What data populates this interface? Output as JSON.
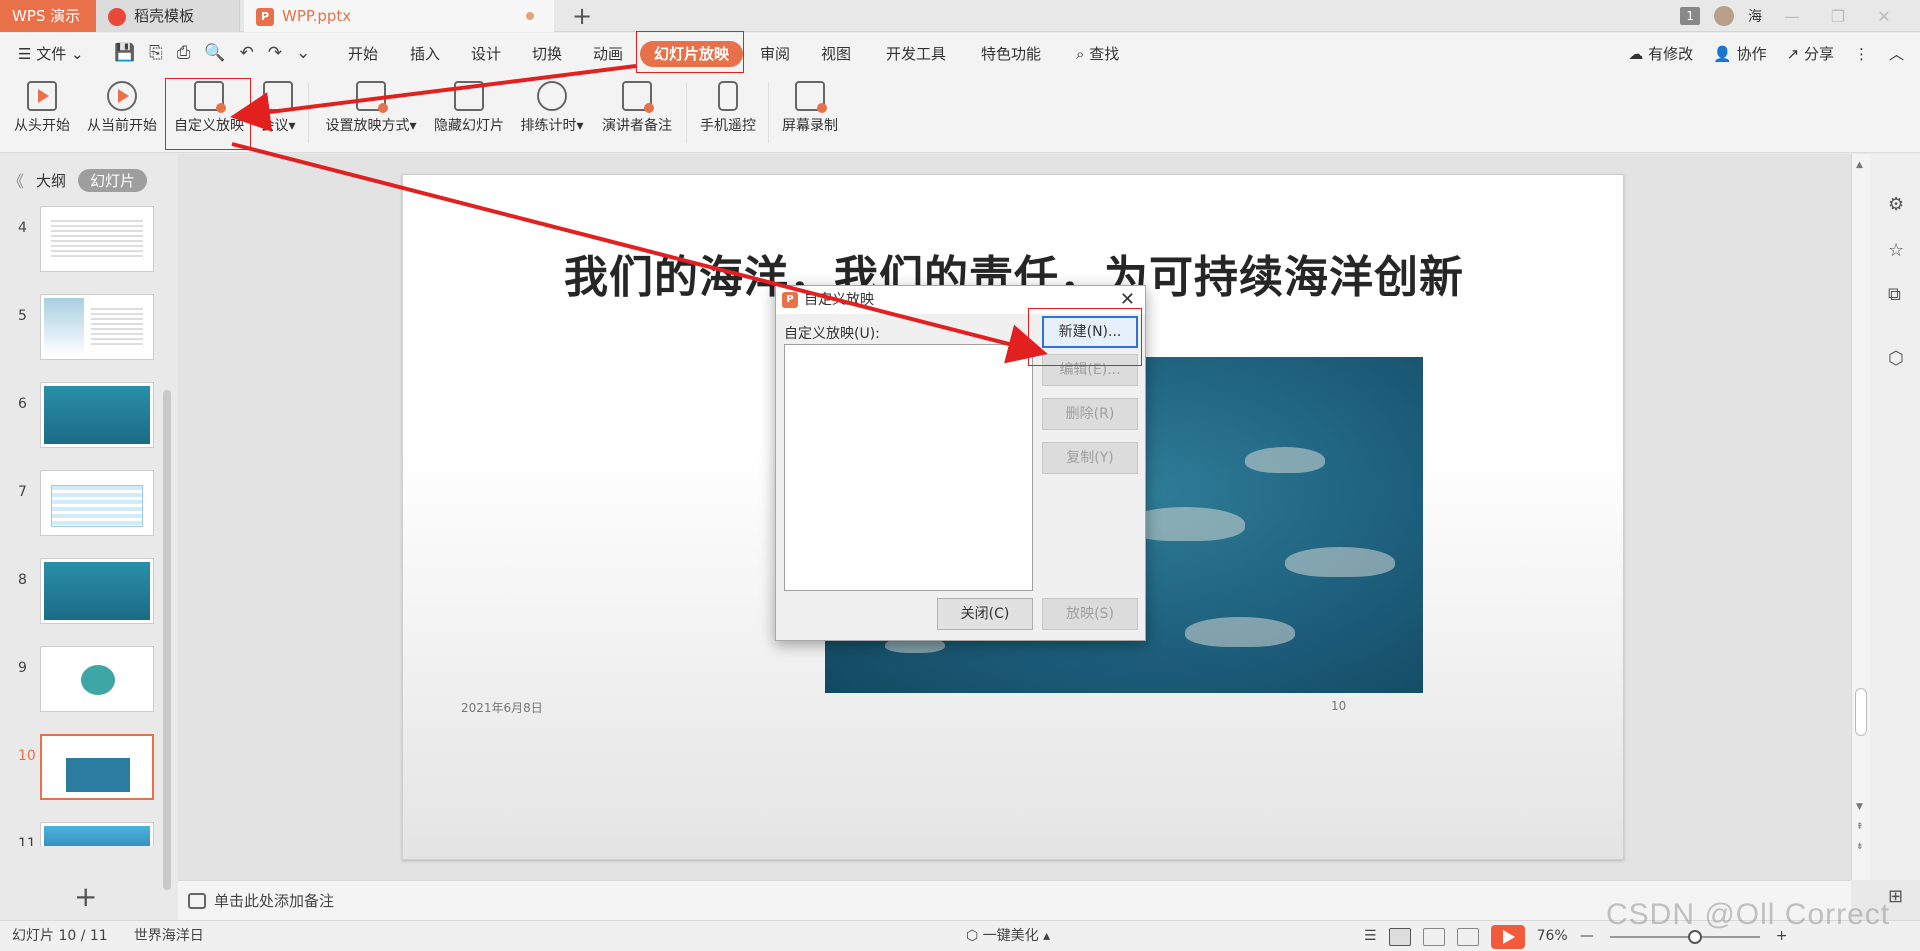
{
  "titlebar": {
    "app_tab": "WPS 演示",
    "tabs": [
      {
        "label": "稻壳模板"
      },
      {
        "label": "WPP.pptx"
      }
    ],
    "add_tab": "+",
    "window_count": "1",
    "user_name": "海",
    "minimize": "—",
    "restore": "❐",
    "close": "✕"
  },
  "menu": {
    "file": "☰ 文件 ⌄",
    "items": [
      "开始",
      "插入",
      "设计",
      "切换",
      "动画",
      "幻灯片放映",
      "审阅",
      "视图",
      "开发工具",
      "特色功能"
    ],
    "search": "查找",
    "right": [
      "有修改",
      "协作",
      "分享"
    ],
    "more": "⋮",
    "collapse": "︿"
  },
  "ribbon": {
    "buttons": [
      "从头开始",
      "从当前开始",
      "自定义放映",
      "会议▾",
      "设置放映方式▾",
      "隐藏幻灯片",
      "排练计时▾",
      "演讲者备注",
      "手机遥控",
      "屏幕录制"
    ]
  },
  "left_panel": {
    "collapse": "《",
    "tab_outline": "大纲",
    "tab_slides": "幻灯片",
    "slide_numbers": [
      "4",
      "5",
      "6",
      "7",
      "8",
      "9",
      "10",
      "11"
    ],
    "current_slide": "10",
    "add_slide": "+"
  },
  "slide": {
    "title": "我们的海洋，我们的责任，为可持续海洋创新",
    "date": "2021年6月8日",
    "number": "10"
  },
  "notes": {
    "placeholder": "单击此处添加备注"
  },
  "status": {
    "slide_pos": "幻灯片 10 / 11",
    "theme": "世界海洋日",
    "beautify": "一键美化",
    "zoom": "76%",
    "zoom_out": "—",
    "zoom_in": "+"
  },
  "dialog": {
    "title": "自定义放映",
    "close": "✕",
    "list_label": "自定义放映(U):",
    "new": "新建(N)...",
    "edit": "编辑(E)...",
    "delete": "删除(R)",
    "copy": "复制(Y)",
    "close_btn": "关闭(C)",
    "show": "放映(S)"
  },
  "watermark": "CSDN @Oll Correct",
  "colors": {
    "accent": "#e8714a",
    "annotation": "#e22020",
    "primary_button_border": "#2d74d8"
  }
}
